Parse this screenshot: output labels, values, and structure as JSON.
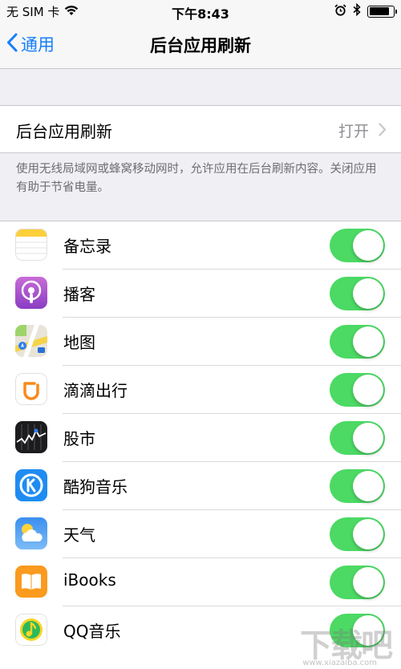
{
  "status_bar": {
    "carrier": "无 SIM 卡",
    "wifi_icon": "wifi-icon",
    "time": "下午8:43",
    "alarm_icon": "alarm-clock-icon",
    "bluetooth_icon": "bluetooth-icon",
    "battery_level": 0.85
  },
  "nav": {
    "back_label": "通用",
    "title": "后台应用刷新"
  },
  "master": {
    "label": "后台应用刷新",
    "value": "打开"
  },
  "footnote": "使用无线局域网或蜂窝移动网时，允许应用在后台刷新内容。关闭应用有助于节省电量。",
  "apps": [
    {
      "name": "备忘录",
      "icon": "notes-icon",
      "enabled": true
    },
    {
      "name": "播客",
      "icon": "podcasts-icon",
      "enabled": true
    },
    {
      "name": "地图",
      "icon": "maps-icon",
      "enabled": true
    },
    {
      "name": "滴滴出行",
      "icon": "didi-icon",
      "enabled": true
    },
    {
      "name": "股市",
      "icon": "stocks-icon",
      "enabled": true
    },
    {
      "name": "酷狗音乐",
      "icon": "kugou-icon",
      "enabled": true
    },
    {
      "name": "天气",
      "icon": "weather-icon",
      "enabled": true
    },
    {
      "name": "iBooks",
      "icon": "ibooks-icon",
      "enabled": true
    },
    {
      "name": "QQ音乐",
      "icon": "qq-music-icon",
      "enabled": true
    }
  ],
  "colors": {
    "accent": "#157efb",
    "toggle_on": "#4cd964",
    "background": "#efeff4"
  },
  "watermark": {
    "logo_text": "下载吧",
    "url_text": "www.xiazaiba.com"
  }
}
